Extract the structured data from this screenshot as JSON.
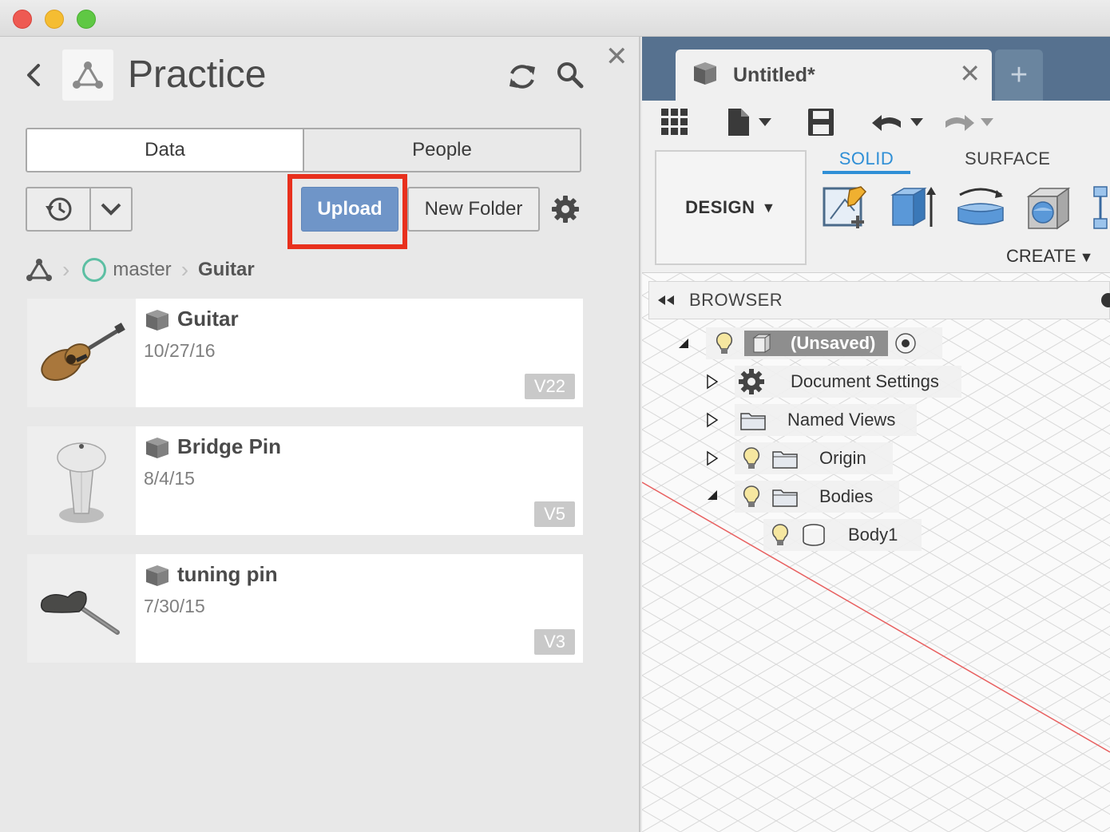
{
  "window": {
    "controls": [
      "close",
      "minimize",
      "zoom"
    ]
  },
  "data_panel": {
    "project_title": "Practice",
    "tabs": [
      {
        "label": "Data",
        "active": true
      },
      {
        "label": "People",
        "active": false
      }
    ],
    "upload_label": "Upload",
    "new_folder_label": "New Folder",
    "breadcrumb": {
      "branch": "master",
      "current": "Guitar"
    },
    "items": [
      {
        "name": "Guitar",
        "date": "10/27/16",
        "version": "V22",
        "thumb": "guitar"
      },
      {
        "name": "Bridge Pin",
        "date": "8/4/15",
        "version": "V5",
        "thumb": "bridge-pin"
      },
      {
        "name": "tuning pin",
        "date": "7/30/15",
        "version": "V3",
        "thumb": "tuning-pin"
      }
    ],
    "highlight_color": "#e8301d",
    "upload_color": "#6f95c8"
  },
  "fusion": {
    "document_tab": {
      "title": "Untitled*"
    },
    "workspace": "DESIGN",
    "ribbon_tabs": {
      "active": "SOLID",
      "other": "SURFACE"
    },
    "create_label": "CREATE",
    "browser": {
      "title": "BROWSER",
      "root": "(Unsaved)",
      "nodes": {
        "document_settings": "Document Settings",
        "named_views": "Named Views",
        "origin": "Origin",
        "bodies": "Bodies",
        "body1": "Body1"
      }
    },
    "accent_color": "#2f8fd6",
    "tabbar_color": "#56718f"
  }
}
